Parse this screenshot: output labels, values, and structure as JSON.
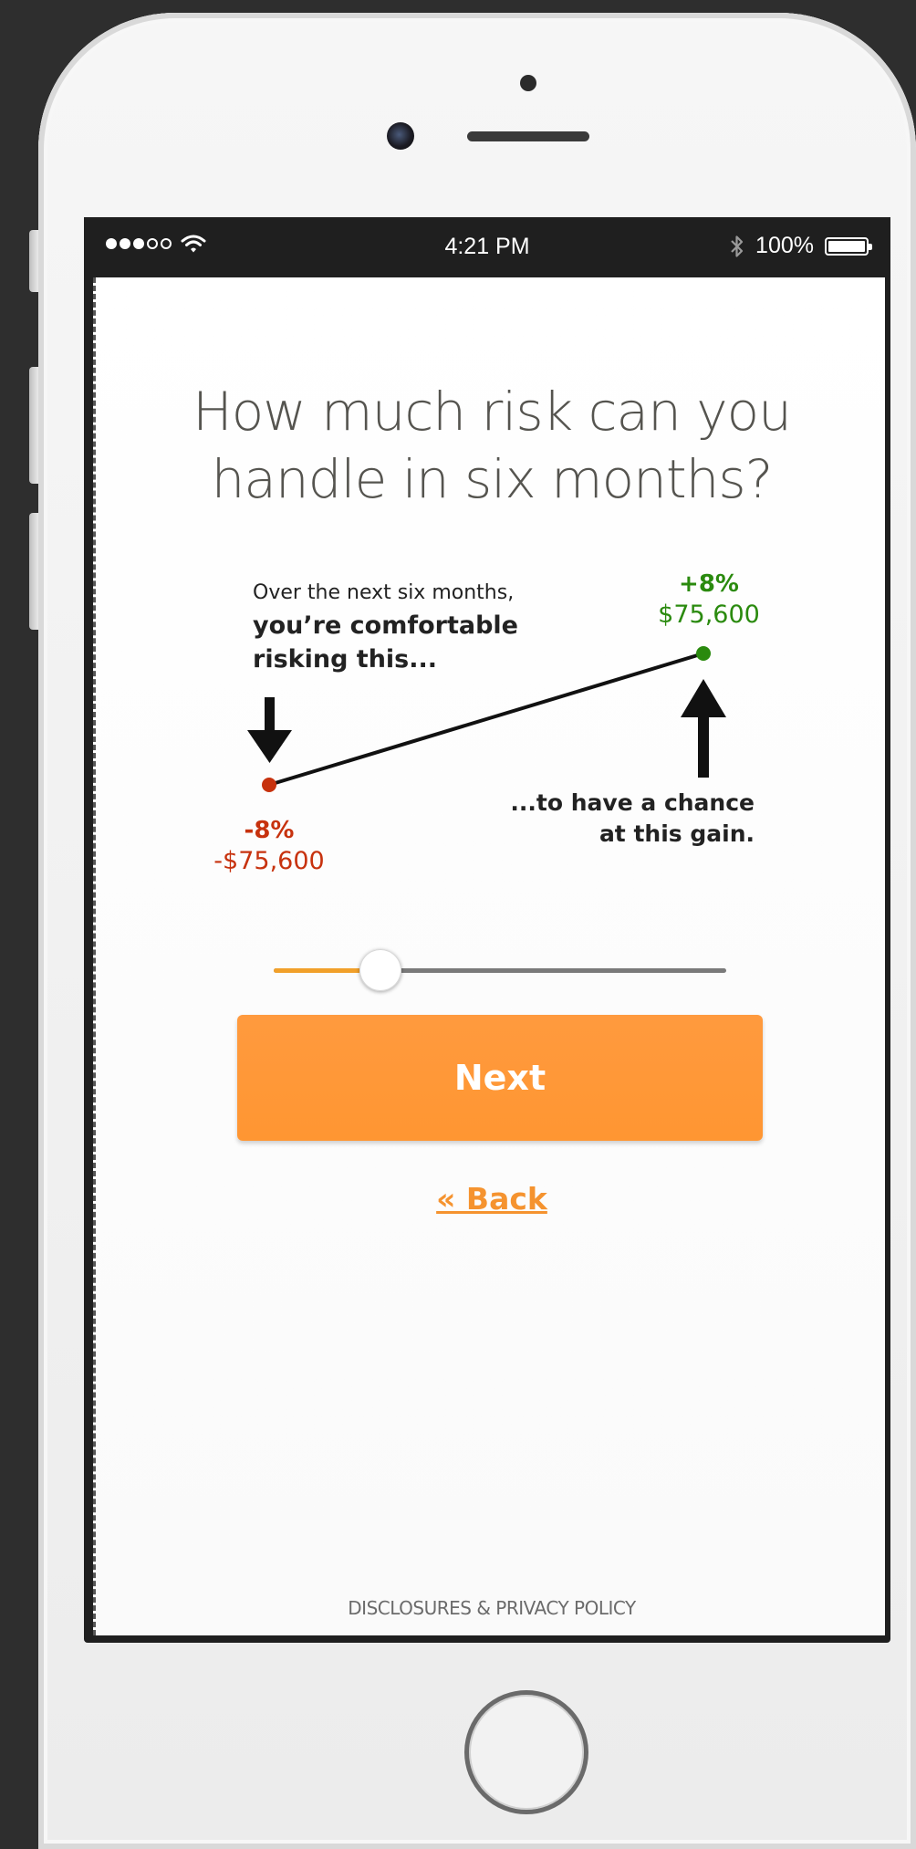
{
  "status_bar": {
    "signal_full": 3,
    "signal_empty": 2,
    "wifi_icon": "wifi-icon",
    "time": "4:21 PM",
    "bluetooth_icon": "bluetooth-icon",
    "battery_percent": "100%"
  },
  "question": {
    "line1": "How much risk can you",
    "line2": "handle in six months?"
  },
  "diagram": {
    "intro_line1": "Over the next six months,",
    "intro_line2": "you’re comfortable",
    "intro_line3": "risking this...",
    "gain_label_line1": "...to have a chance",
    "gain_label_line2": "at this gain.",
    "loss_percent": "-8%",
    "loss_amount": "-$75,600",
    "gain_percent": "+8%",
    "gain_amount": "$75,600",
    "colors": {
      "loss": "#c7320e",
      "gain": "#2a8a0e",
      "line": "#111111"
    }
  },
  "slider": {
    "value": 0.235,
    "fill_color": "#f1a02a",
    "track_color": "#7a7a7a"
  },
  "actions": {
    "next_label": "Next",
    "back_label": "« Back",
    "accent_color": "#ff9632"
  },
  "footer": {
    "disclosures_label": "DISCLOSURES & PRIVACY POLICY"
  }
}
